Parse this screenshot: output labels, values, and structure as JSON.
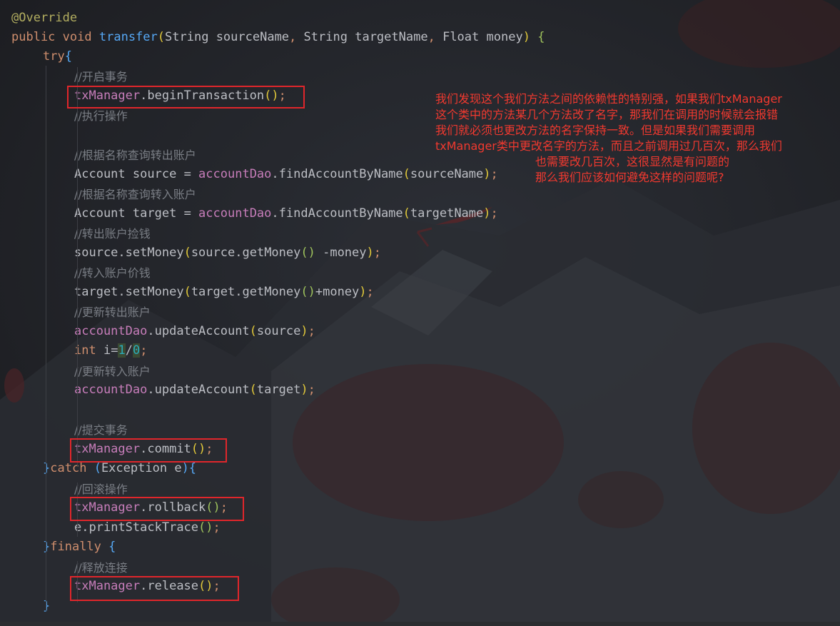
{
  "code": {
    "annotation": "@Override",
    "method_kw": "public",
    "void_kw": "void",
    "method_name": "transfer",
    "sig_p1_type": "String",
    "sig_p1_name": "sourceName",
    "sig_p2_type": "String",
    "sig_p2_name": "targetName",
    "sig_p3_type": "Float",
    "sig_p3_name": "money",
    "try_kw": "try",
    "c_begin": "//开启事务",
    "txManager": "txManager",
    "begin_call": "beginTransaction",
    "c_exec": "//执行操作",
    "c_query_out": "//根据名称查询转出账户",
    "account_type": "Account",
    "source_var": "source",
    "accountDao": "accountDao",
    "find_call": "findAccountByName",
    "source_arg": "sourceName",
    "c_query_in": "//根据名称查询转入账户",
    "target_var": "target",
    "target_arg": "targetName",
    "c_out": "//转出账户捡钱",
    "set_money": "setMoney",
    "get_money": "getMoney",
    "minus_money": " -money",
    "c_in": "//转入账户价钱",
    "plus_money": "+money",
    "c_update_out": "//更新转出账户",
    "update_call": "updateAccount",
    "int_kw": "int",
    "i_assign": " i=",
    "one": "1",
    "slash": "/",
    "zero": "0",
    "c_update_in": "//更新转入账户",
    "c_commit": "//提交事务",
    "commit_call": "commit",
    "catch_kw": "catch",
    "exception_type": "Exception",
    "e_var": "e",
    "c_rollback": "//回滚操作",
    "rollback_call": "rollback",
    "print_call": "printStackTrace",
    "finally_kw": "finally",
    "c_release": "//释放连接",
    "release_call": "release"
  },
  "note_lines": [
    "我们发现这个我们方法之间的依赖性的特别强，如果我们txManager",
    "这个类中的方法某几个方法改了名字，那我们在调用的时候就会报错",
    "我们就必须也更改方法的名字保持一致。但是如果我们需要调用",
    "txManager类中更改名字的方法，而且之前调用过几百次，那么我们",
    "也需要改几百次，这很显然是有问题的",
    "那么我们应该如何避免这样的问题呢?"
  ],
  "colors": {
    "background": "#1f2125",
    "highlight_box": "#e0262b",
    "note_text": "#f2392f",
    "keyword": "#cf8e6d",
    "field": "#c77dba",
    "method": "#56a8f5",
    "comment": "#7a7e85"
  }
}
